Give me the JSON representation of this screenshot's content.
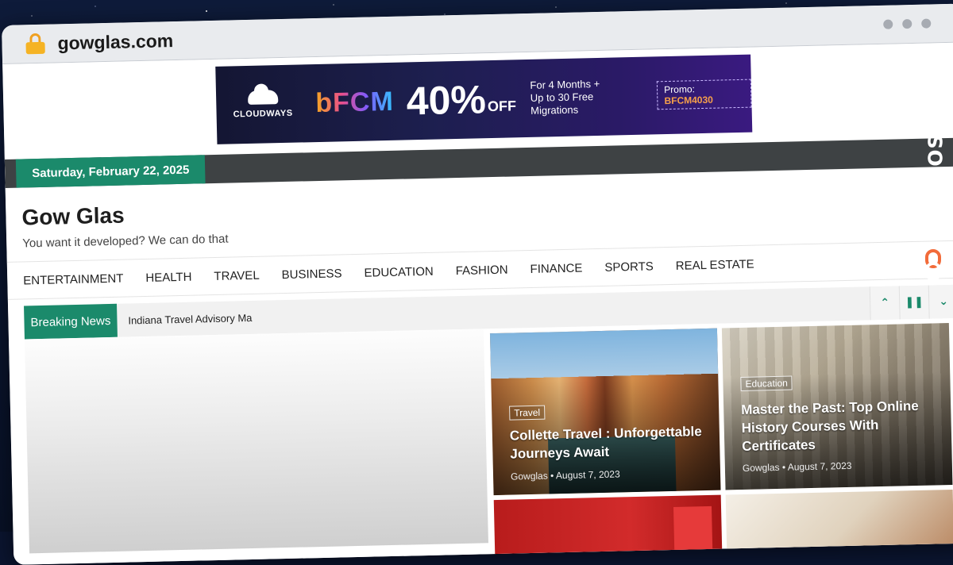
{
  "browser": {
    "url": "gowglas.com"
  },
  "ad": {
    "brand": "CLOUDWAYS",
    "event": "bFCM",
    "percent": "40%",
    "off": "OFF",
    "offer_line1": "For 4 Months +",
    "offer_line2": "Up to 30 Free Migrations",
    "promo_label": "Promo:",
    "promo_code": "BFCM4030"
  },
  "topbar": {
    "date": "Saturday, February 22, 2025"
  },
  "site": {
    "title": "Gow Glas",
    "tagline": "You want it developed? We can do that"
  },
  "nav": {
    "items": [
      "ENTERTAINMENT",
      "HEALTH",
      "TRAVEL",
      "BUSINESS",
      "EDUCATION",
      "FASHION",
      "FINANCE",
      "SPORTS",
      "REAL ESTATE"
    ]
  },
  "breaking": {
    "label": "Breaking News",
    "headline": "Indiana Travel Advisory Ma"
  },
  "cards": [
    {
      "category": "Travel",
      "title": "Collette Travel : Unforgettable Journeys Await",
      "author": "Gowglas",
      "date": "August 7, 2023"
    },
    {
      "category": "Education",
      "title": "Master the Past: Top Online History Courses With Certificates",
      "author": "Gowglas",
      "date": "August 7, 2023"
    }
  ],
  "watermark": {
    "text": "GUESTPOSTLINKS"
  },
  "colors": {
    "accent": "#1b8a6b",
    "topbar": "#3e4244",
    "watermark_logo": "#f26b3a"
  }
}
